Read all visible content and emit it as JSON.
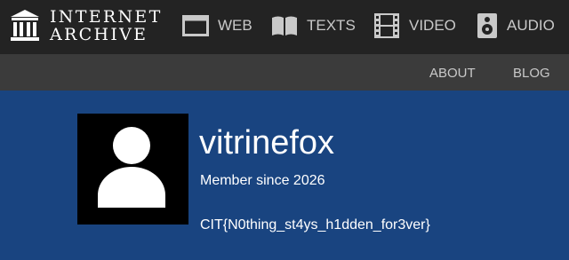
{
  "brand": {
    "line1": "INTERNET",
    "line2": "ARCHIVE"
  },
  "nav": {
    "web": "WEB",
    "texts": "TEXTS",
    "video": "VIDEO",
    "audio": "AUDIO"
  },
  "subnav": {
    "about": "ABOUT",
    "blog": "BLOG"
  },
  "profile": {
    "username": "vitrinefox",
    "member_since": "Member since 2026",
    "bio": "CIT{N0thing_st4ys_h1dden_for3ver}"
  },
  "icons": {
    "logo": "archive-building-icon",
    "web": "browser-window-icon",
    "texts": "open-book-icon",
    "video": "film-strip-icon",
    "audio": "speaker-icon",
    "avatar": "user-silhouette-icon"
  },
  "colors": {
    "topbar": "#232323",
    "subbar": "#3b3b3b",
    "profile_bg": "#194480",
    "nav_text": "#c9c9c9"
  }
}
